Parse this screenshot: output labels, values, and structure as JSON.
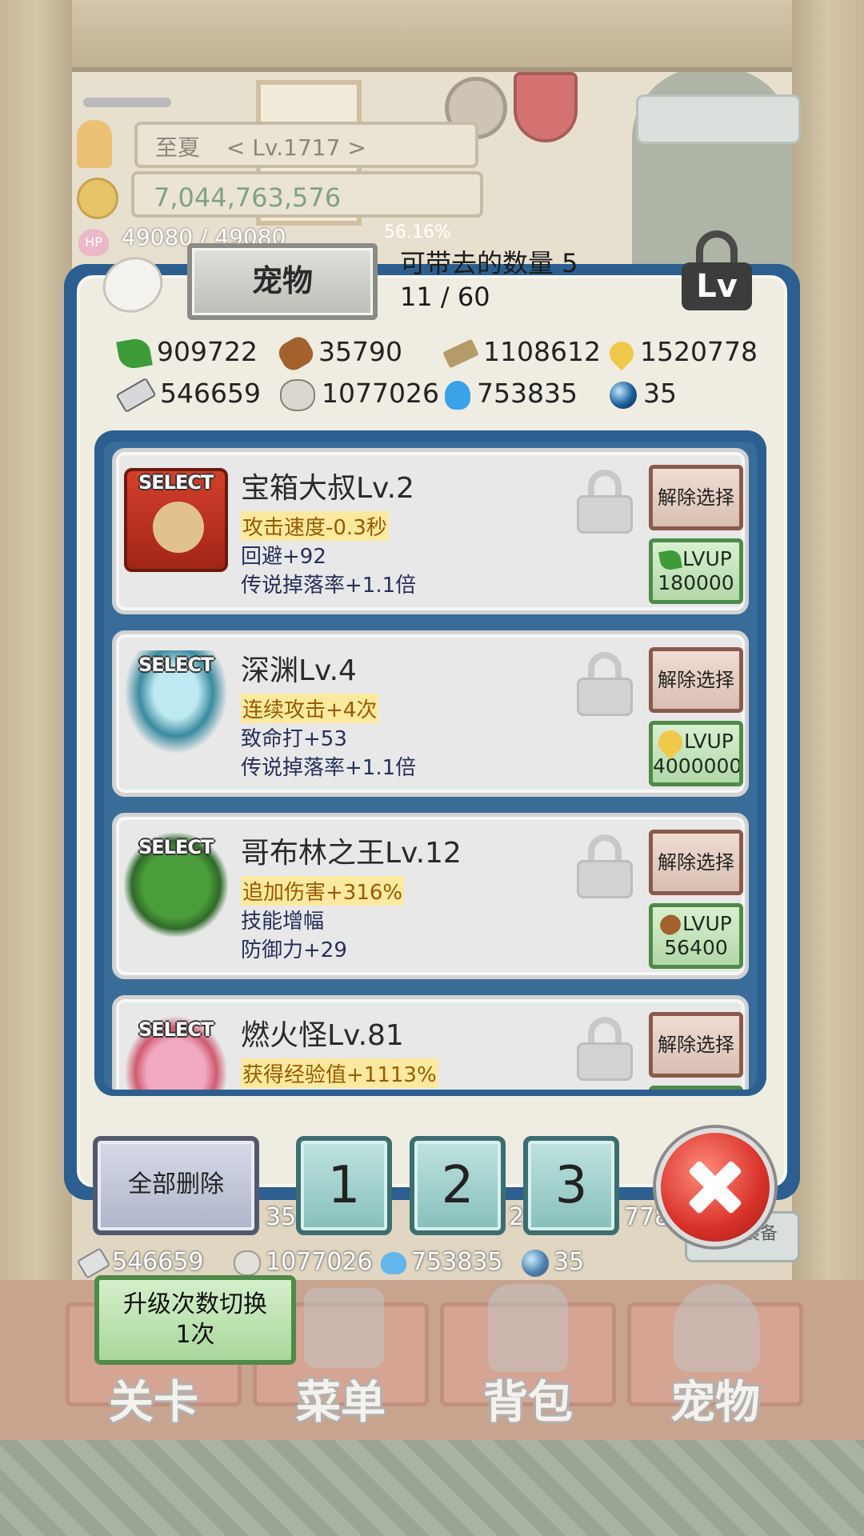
{
  "hud": {
    "player_name": "至夏",
    "player_level": "< Lv.1717 >",
    "gold": "7,044,763,576",
    "hp": "49080 / 49080",
    "exp_percent": "56.16%",
    "hp_icon_label": "HP"
  },
  "dialog": {
    "title_tab": "宠物",
    "carry_label": "可带去的数量 5",
    "carry_count": "11 / 60",
    "lv_lock_label": "Lv",
    "resources": [
      {
        "icon": "leaf-icon",
        "value": "909722"
      },
      {
        "icon": "wood-log-icon",
        "value": "35790"
      },
      {
        "icon": "plank-icon",
        "value": "1108612"
      },
      {
        "icon": "drop-icon",
        "value": "1520778"
      },
      {
        "icon": "iron-ingot-icon",
        "value": "546659"
      },
      {
        "icon": "stone-icon",
        "value": "1077026"
      },
      {
        "icon": "blue-flame-icon",
        "value": "753835"
      },
      {
        "icon": "orb-icon",
        "value": "35"
      }
    ],
    "select_tag": "SELECT",
    "deselect_label": "解除选择",
    "lvup_label": "LVUP",
    "pets": [
      {
        "name": "宝箱大叔Lv.2",
        "stat1": "攻击速度-0.3秒",
        "stat2": "回避+92",
        "stat3": "传说掉落率+1.1倍",
        "lvup_cost": "180000",
        "cost_icon": "leaf-icon"
      },
      {
        "name": "深渊Lv.4",
        "stat1": "连续攻击+4次",
        "stat2": "致命打+53",
        "stat3": "传说掉落率+1.1倍",
        "lvup_cost": "4000000",
        "cost_icon": "drop-icon"
      },
      {
        "name": "哥布林之王Lv.12",
        "stat1": "追加伤害+316%",
        "stat2": "技能增幅",
        "stat3": "防御力+29",
        "lvup_cost": "56400",
        "cost_icon": "wood-log-icon"
      },
      {
        "name": "燃火怪Lv.81",
        "stat1": "获得经验值+1113%",
        "stat2": "",
        "stat3": "",
        "lvup_cost": "",
        "cost_icon": "leaf-icon"
      }
    ],
    "delete_all_label": "全部删除",
    "preset_buttons": [
      "1",
      "2",
      "3"
    ]
  },
  "background_panel": {
    "resources_row1_partial": [
      "35",
      "2",
      "778"
    ],
    "resources_row2": [
      "546659",
      "1077026",
      "753835",
      "35"
    ],
    "equip_all_label": "全部装备"
  },
  "bottom_menu": {
    "upgrade_toggle_line1": "升级次数切换",
    "upgrade_toggle_line2": "1次",
    "tabs": [
      "关卡",
      "菜单",
      "背包",
      "宠物"
    ]
  },
  "colors": {
    "dialog_frame": "#2c5f8f",
    "highlight_stat_bg": "#fbe9a0",
    "deselect_border": "#8a5a4a",
    "lvup_border": "#4f8a48",
    "close_red": "#d8322a"
  }
}
